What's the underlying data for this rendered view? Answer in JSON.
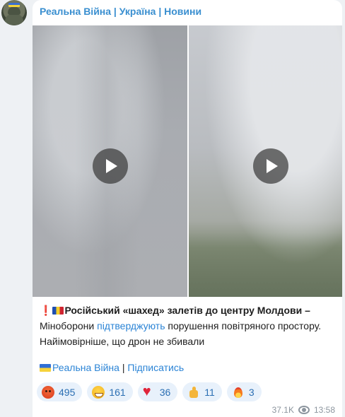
{
  "channel": {
    "name": "Реальна Війна | Україна | Новини"
  },
  "post": {
    "text_bold": "Російський «шахед» залетів до центру Молдови –",
    "text_part1": "Міноборони ",
    "link_text": "підтверджують",
    "text_part2": " порушення повітряного простору.",
    "text_line3": "Найімовірніше, що дрон не збивали"
  },
  "footer": {
    "channel_link": "Реальна Війна",
    "separator": " | ",
    "subscribe_link": "Підписатись"
  },
  "reactions": [
    {
      "icon": "angry-face-icon",
      "count": "495"
    },
    {
      "icon": "grinning-face-icon",
      "count": "161"
    },
    {
      "icon": "heart-icon",
      "count": "36"
    },
    {
      "icon": "thumbs-up-icon",
      "count": "11"
    },
    {
      "icon": "fire-icon",
      "count": "3"
    }
  ],
  "meta": {
    "views": "37.1K",
    "time": "13:58"
  },
  "colors": {
    "link": "#2b84d6",
    "channel_name": "#3a8fd0",
    "reaction_bg": "#e8f1fb"
  }
}
